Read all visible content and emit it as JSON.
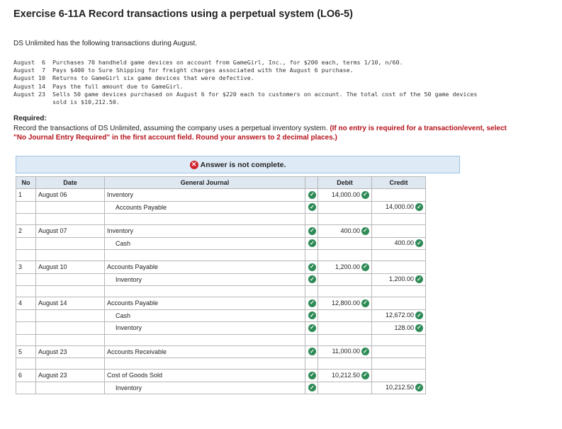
{
  "title": "Exercise 6-11A Record transactions using a perpetual system (LO6-5)",
  "intro": "DS Unlimited has the following transactions during August.",
  "transactions": [
    {
      "date": "August  6",
      "desc": "Purchases 70 handheld game devices on account from GameGirl, Inc., for $200 each, terms 1/10, n/60."
    },
    {
      "date": "August  7",
      "desc": "Pays $400 to Sure Shipping for freight charges associated with the August 6 purchase."
    },
    {
      "date": "August 10",
      "desc": "Returns to GameGirl six game devices that were defective."
    },
    {
      "date": "August 14",
      "desc": "Pays the full amount due to GameGirl."
    },
    {
      "date": "August 23",
      "desc": "Sells 50 game devices purchased on August 6 for $220 each to customers on account. The total cost of the 50 game devices\nsold is $10,212.50."
    }
  ],
  "required_label": "Required:",
  "required_text": "Record the transactions of DS Unlimited, assuming the company uses a perpetual inventory system.",
  "required_note": "(If no entry is required for a transaction/event, select \"No Journal Entry Required\" in the first account field. Round your answers to 2 decimal places.)",
  "banner": {
    "icon": "x-circle-icon",
    "text": "Answer is not complete."
  },
  "table": {
    "headers": {
      "no": "No",
      "date": "Date",
      "journal": "General Journal",
      "debit": "Debit",
      "credit": "Credit"
    },
    "entries": [
      {
        "no": "1",
        "date": "August 06",
        "lines": [
          {
            "account": "Inventory",
            "indent": false,
            "debit": "14,000.00",
            "credit": ""
          },
          {
            "account": "Accounts Payable",
            "indent": true,
            "debit": "",
            "credit": "14,000.00"
          }
        ]
      },
      {
        "no": "2",
        "date": "August 07",
        "lines": [
          {
            "account": "Inventory",
            "indent": false,
            "debit": "400.00",
            "credit": ""
          },
          {
            "account": "Cash",
            "indent": true,
            "debit": "",
            "credit": "400.00"
          }
        ]
      },
      {
        "no": "3",
        "date": "August 10",
        "lines": [
          {
            "account": "Accounts Payable",
            "indent": false,
            "debit": "1,200.00",
            "credit": ""
          },
          {
            "account": "Inventory",
            "indent": true,
            "debit": "",
            "credit": "1,200.00"
          }
        ]
      },
      {
        "no": "4",
        "date": "August 14",
        "lines": [
          {
            "account": "Accounts Payable",
            "indent": false,
            "debit": "12,800.00",
            "credit": ""
          },
          {
            "account": "Cash",
            "indent": true,
            "debit": "",
            "credit": "12,672.00"
          },
          {
            "account": "Inventory",
            "indent": true,
            "debit": "",
            "credit": "128.00"
          }
        ]
      },
      {
        "no": "5",
        "date": "August 23",
        "lines": [
          {
            "account": "Accounts Receivable",
            "indent": false,
            "debit": "11,000.00",
            "credit": ""
          }
        ]
      },
      {
        "no": "6",
        "date": "August 23",
        "lines": [
          {
            "account": "Cost of Goods Sold",
            "indent": false,
            "debit": "10,212.50",
            "credit": ""
          },
          {
            "account": "Inventory",
            "indent": true,
            "debit": "",
            "credit": "10,212.50"
          }
        ]
      }
    ]
  },
  "colors": {
    "correct": "#2e8b57",
    "incorrect": "#d0242b",
    "required_note": "#b5121b",
    "header_bg": "#dfe7f1",
    "banner_bg": "#deebf7"
  },
  "icons": {
    "correct": "check-circle-icon",
    "incorrect": "x-circle-icon"
  }
}
